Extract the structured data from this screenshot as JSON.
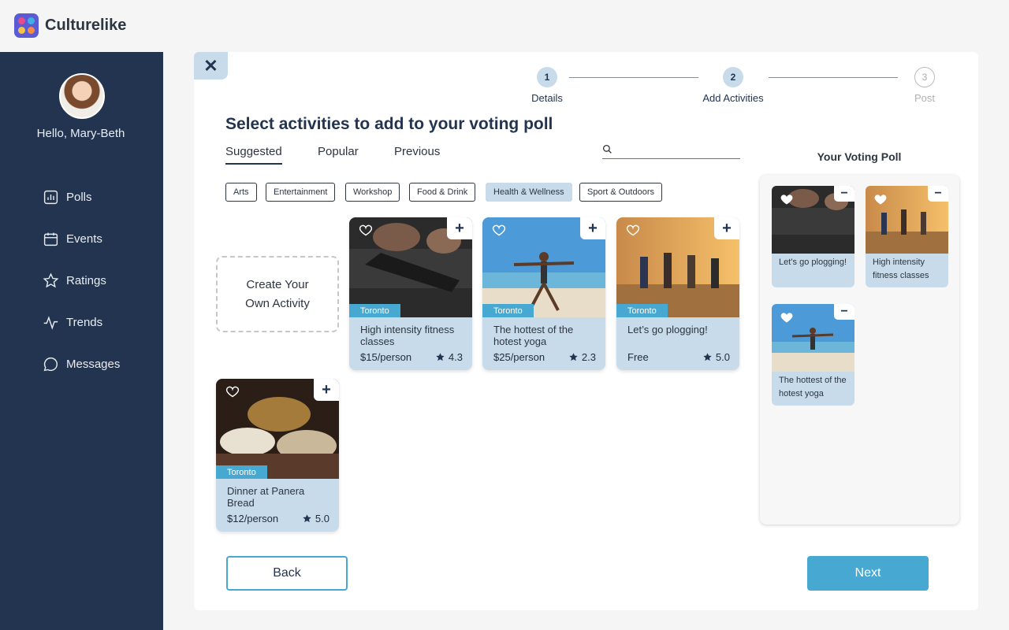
{
  "brand": {
    "name": "Culturelike"
  },
  "sidebar": {
    "greeting": "Hello, Mary-Beth",
    "items": [
      {
        "label": "Polls",
        "icon": "bar-chart-icon"
      },
      {
        "label": "Events",
        "icon": "calendar-icon"
      },
      {
        "label": "Ratings",
        "icon": "star-icon"
      },
      {
        "label": "Trends",
        "icon": "pulse-icon"
      },
      {
        "label": "Messages",
        "icon": "chat-bubble-icon"
      }
    ]
  },
  "stepper": {
    "steps": [
      {
        "number": "1",
        "label": "Details"
      },
      {
        "number": "2",
        "label": "Add Activities"
      },
      {
        "number": "3",
        "label": "Post"
      }
    ]
  },
  "main": {
    "heading": "Select activities to add to your voting poll",
    "tabs": [
      "Suggested",
      "Popular",
      "Previous"
    ],
    "search": {
      "placeholder": ""
    },
    "filters": [
      "Arts",
      "Entertainment",
      "Workshop",
      "Food & Drink",
      "Health & Wellness",
      "Sport & Outdoors"
    ],
    "create_card": {
      "line1": "Create Your",
      "line2": "Own Activity"
    },
    "activities": [
      {
        "location": "Toronto",
        "title": "High intensity fitness classes",
        "price": "$15/person",
        "rating": "4.3"
      },
      {
        "location": "Toronto",
        "title": "The hottest of the hotest yoga",
        "price": "$25/person",
        "rating": "2.3"
      },
      {
        "location": "Toronto",
        "title": "Let’s go plogging!",
        "price": "Free",
        "rating": "5.0"
      },
      {
        "location": "Toronto",
        "title": "Dinner at Panera Bread",
        "price": "$12/person",
        "rating": "5.0"
      }
    ]
  },
  "poll": {
    "title": "Your Voting Poll",
    "items": [
      {
        "title": "Let’s go plogging!"
      },
      {
        "title": "High intensity fitness classes"
      },
      {
        "title": "The hottest of the hotest yoga"
      }
    ]
  },
  "footer": {
    "back_label": "Back",
    "next_label": "Next"
  },
  "colors": {
    "sidebar": "#223450",
    "accent": "#47a8d1",
    "card": "#c7dbea"
  }
}
